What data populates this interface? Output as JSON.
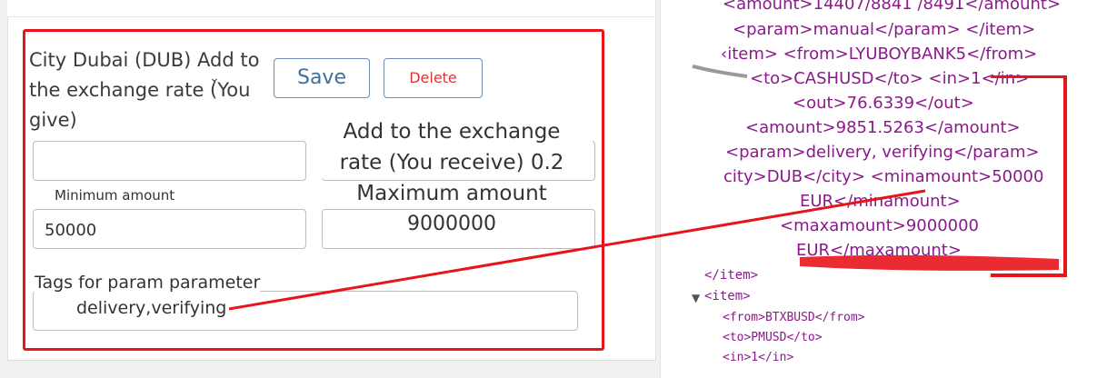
{
  "form": {
    "city_label": "City Dubai (DUB) Add to",
    "rate_give_label_line2": "the exchange rate (You",
    "rate_give_label_line3": "give)",
    "save_label": "Save",
    "delete_label": "Delete",
    "rate_receive_label_line1": "Add to the exchange",
    "rate_receive_label_line2": "rate (You receive) 0.2",
    "min_amount_label": "Minimum amount",
    "min_amount_value": "50000",
    "max_amount_label": "Maximum amount",
    "max_amount_value": "9000000",
    "tags_label": "Tags for param parameter",
    "tags_value": "delivery,verifying"
  },
  "xml": {
    "line0": "<amount>14407/8841 /8491</amount>",
    "line1": "<param>manual</param> </item>",
    "line2": "‹item> <from>LYUBOYBANK5</from>",
    "line3": "<to>CASHUSD</to> <in>1</in>",
    "line4": "<out>76.6339</out>",
    "line5": "<amount>9851.5263</amount>",
    "line6": "<param>delivery, verifying</param>",
    "line7": "city>DUB</city> <minamount>50000",
    "line8": "EUR</minamount>",
    "line9": "<maxamount>9000000",
    "line10": "EUR</maxamount>",
    "line11": "</item>",
    "line12": "<item>",
    "line13": "<from>BTXBUSD</from>",
    "line14": "<to>PMUSD</to>",
    "line15": "<in>1</in>"
  },
  "colors": {
    "annotation_red": "#e8141b",
    "xml_tag": "#8a1a8a",
    "button_border": "#6b8db4",
    "delete_text": "#dd3333"
  }
}
